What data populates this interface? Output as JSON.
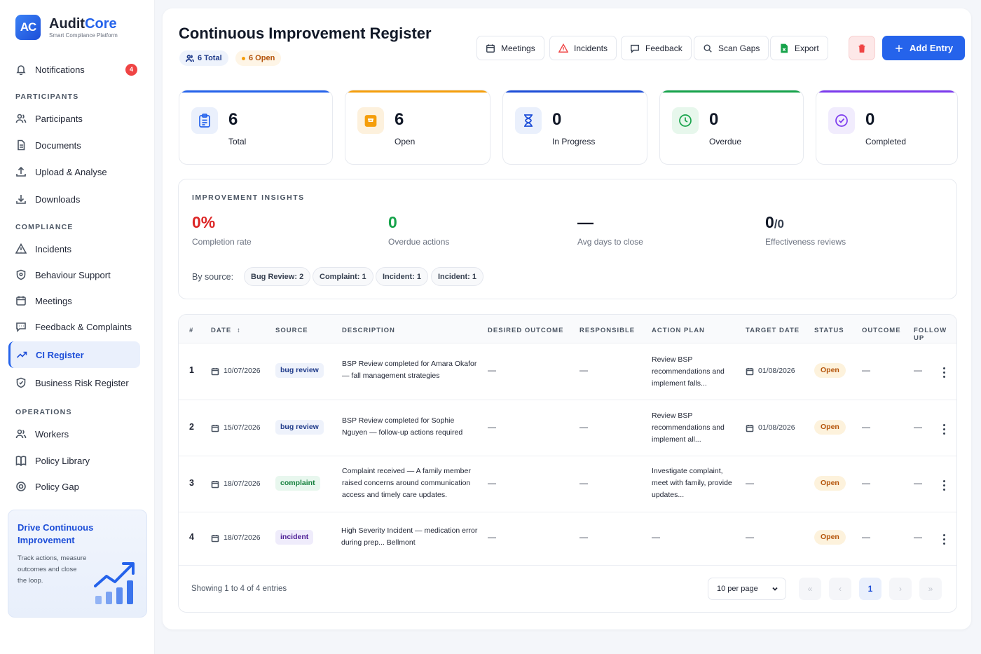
{
  "brand": {
    "name_a": "Audit",
    "name_b": "Core",
    "logo": "AC",
    "tagline": "Smart Compliance Platform"
  },
  "sidebar": {
    "notifications": {
      "label": "Notifications",
      "badge": "4"
    },
    "sections": {
      "participants": "PARTICIPANTS",
      "compliance": "COMPLIANCE",
      "operations": "OPERATIONS"
    },
    "items": [
      {
        "label": "Participants",
        "icon": "users-icon"
      },
      {
        "label": "Documents",
        "icon": "document-icon"
      },
      {
        "label": "Upload & Analyse",
        "icon": "upload-icon"
      },
      {
        "label": "Downloads",
        "icon": "download-icon"
      },
      {
        "label": "Incidents",
        "icon": "warning-icon"
      },
      {
        "label": "Behaviour Support",
        "icon": "shield-icon"
      },
      {
        "label": "Meetings",
        "icon": "calendar-icon"
      },
      {
        "label": "Feedback & Complaints",
        "icon": "chat-icon"
      },
      {
        "label": "CI Register",
        "icon": "trend-icon",
        "active": true
      },
      {
        "label": "Business Risk Register",
        "icon": "shield-icon"
      },
      {
        "label": "Workers",
        "icon": "users-icon"
      },
      {
        "label": "Policy Library",
        "icon": "book-icon"
      },
      {
        "label": "Policy Gap",
        "icon": "target-icon"
      }
    ],
    "promo": {
      "title": "Drive Continuous Improvement",
      "text": "Track actions, measure outcomes and close the loop."
    }
  },
  "header": {
    "title": "Continuous Improvement Register",
    "total_pill": "6 Total",
    "open_pill": "6 Open",
    "buttons": {
      "meetings": "Meetings",
      "incidents": "Incidents",
      "feedback": "Feedback",
      "scan_gaps": "Scan Gaps",
      "export": "Export",
      "add_entry": "Add Entry"
    }
  },
  "stats": [
    {
      "value": "6",
      "label": "Total",
      "color": "#2563eb"
    },
    {
      "value": "6",
      "label": "Open",
      "color": "#f59e0b"
    },
    {
      "value": "0",
      "label": "In Progress",
      "color": "#1d4ed8"
    },
    {
      "value": "0",
      "label": "Overdue",
      "color": "#16a34a"
    },
    {
      "value": "0",
      "label": "Completed",
      "color": "#7c3aed"
    }
  ],
  "insights": {
    "title": "IMPROVEMENT INSIGHTS",
    "completion_rate": {
      "value": "0%",
      "label": "Completion rate"
    },
    "overdue_actions": {
      "value": "0",
      "label": "Overdue actions"
    },
    "avg_days": {
      "value": "—",
      "label": "Avg days to close"
    },
    "effectiveness": {
      "value": "0",
      "suffix": "/0",
      "label": "Effectiveness reviews"
    },
    "by_source_label": "By source:",
    "sources": [
      "Bug Review: 2",
      "Complaint: 1",
      "Incident: 1",
      "Incident: 1"
    ]
  },
  "table": {
    "columns": {
      "idx": "#",
      "date": "DATE",
      "source": "SOURCE",
      "description": "DESCRIPTION",
      "desired_outcome": "DESIRED OUTCOME",
      "responsible": "RESPONSIBLE",
      "action_plan": "ACTION PLAN",
      "target_date": "TARGET DATE",
      "status": "STATUS",
      "outcome": "OUTCOME",
      "follow_up": "FOLLOW UP"
    },
    "rows": [
      {
        "idx": "1",
        "date": "10/07/2026",
        "source": "bug review",
        "source_type": "bug",
        "description": "BSP Review completed for Amara Okafor — fall management strategies",
        "desired_outcome": "—",
        "responsible": "—",
        "action_plan": "Review BSP recommendations and implement falls...",
        "target_date": "01/08/2026",
        "status": "Open",
        "outcome": "—",
        "follow_up": "—"
      },
      {
        "idx": "2",
        "date": "15/07/2026",
        "source": "bug review",
        "source_type": "bug",
        "description": "BSP Review completed for Sophie Nguyen — follow-up actions required",
        "desired_outcome": "—",
        "responsible": "—",
        "action_plan": "Review BSP recommendations and implement all...",
        "target_date": "01/08/2026",
        "status": "Open",
        "outcome": "—",
        "follow_up": "—"
      },
      {
        "idx": "3",
        "date": "18/07/2026",
        "source": "complaint",
        "source_type": "complaint",
        "description": "Complaint received — A family member raised concerns around communication access and timely care updates.",
        "desired_outcome": "—",
        "responsible": "—",
        "action_plan": "Investigate complaint, meet with family, provide updates...",
        "target_date": "—",
        "status": "Open",
        "outcome": "—",
        "follow_up": "—"
      },
      {
        "idx": "4",
        "date": "18/07/2026",
        "source": "incident",
        "source_type": "incident",
        "description": "High Severity Incident — medication error during prep... Bellmont",
        "desired_outcome": "—",
        "responsible": "—",
        "action_plan": "—",
        "target_date": "—",
        "status": "Open",
        "outcome": "—",
        "follow_up": "—"
      }
    ],
    "footer": {
      "showing": "Showing 1 to 4 of 4 entries",
      "per_page": "10 per page",
      "page": "1",
      "first": "«",
      "prev": "‹",
      "next": "›",
      "last": "»"
    }
  }
}
